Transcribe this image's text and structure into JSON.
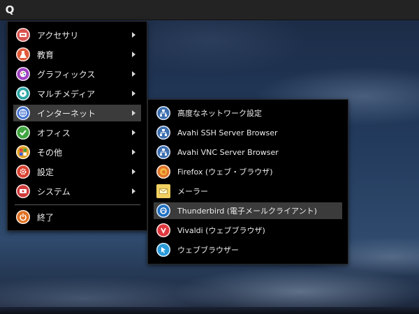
{
  "panel": {
    "launcher_label": "Q"
  },
  "main_menu": {
    "items": [
      {
        "label": "アクセサリ",
        "icon": "accessories-icon",
        "color": "#d9534f",
        "has_submenu": true
      },
      {
        "label": "教育",
        "icon": "education-icon",
        "color": "#e05a3a",
        "has_submenu": true
      },
      {
        "label": "グラフィックス",
        "icon": "graphics-icon",
        "color": "#a040c0",
        "has_submenu": true
      },
      {
        "label": "マルチメディア",
        "icon": "multimedia-icon",
        "color": "#2aa6a6",
        "has_submenu": true
      },
      {
        "label": "インターネット",
        "icon": "internet-icon",
        "color": "#3f6fd1",
        "has_submenu": true
      },
      {
        "label": "オフィス",
        "icon": "office-icon",
        "color": "#3fa53f",
        "has_submenu": true
      },
      {
        "label": "その他",
        "icon": "other-icon",
        "color": "#e0a020",
        "has_submenu": true
      },
      {
        "label": "設定",
        "icon": "settings-icon",
        "color": "#d9402f",
        "has_submenu": true
      },
      {
        "label": "システム",
        "icon": "system-icon",
        "color": "#d03a3a",
        "has_submenu": true
      }
    ],
    "quit": {
      "label": "終了",
      "icon": "quit-icon",
      "color": "#e07020"
    }
  },
  "internet_submenu": {
    "items": [
      {
        "label": "高度なネットワーク設定",
        "icon": "network-icon",
        "color": "#3d6fb0"
      },
      {
        "label": "Avahi SSH Server Browser",
        "icon": "network-icon",
        "color": "#3d6fb0"
      },
      {
        "label": "Avahi VNC Server Browser",
        "icon": "network-icon",
        "color": "#3d6fb0"
      },
      {
        "label": "Firefox (ウェブ・ブラウザ)",
        "icon": "firefox-icon",
        "color": "#e0762b"
      },
      {
        "label": "メーラー",
        "icon": "mail-icon",
        "color": "#f0d060"
      },
      {
        "label": "Thunderbird (電子メールクライアント)",
        "icon": "thunderbird-icon",
        "color": "#1f6fc0"
      },
      {
        "label": "Vivaldi (ウェブブラウザ)",
        "icon": "vivaldi-icon",
        "color": "#e0383e"
      },
      {
        "label": "ウェブブラウザー",
        "icon": "web-browser-icon",
        "color": "#2a9ad8"
      }
    ]
  }
}
